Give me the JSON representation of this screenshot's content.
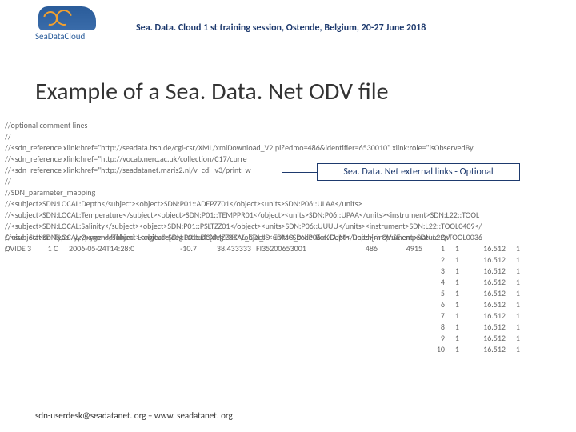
{
  "brand": {
    "name": "SeaDataCloud"
  },
  "header": "Sea. Data. Cloud 1 st training session, Ostende, Belgium, 20-27 June 2018",
  "title": "Example of a Sea. Data. Net ODV file",
  "callout": "Sea. Data. Net external links - Optional",
  "footer": "sdn-userdesk@seadatanet. org – www. seadatanet. org",
  "file": {
    "l0": "//optional comment lines",
    "l1": "//",
    "l2": "//<sdn_reference xlink:href=\"http://seadata.bsh.de/cgi-csr/XML/xmlDownload_V2.pl?edmo=486&identifier=6530010\" xlink:role=\"isObservedBy",
    "l3": "//<sdn_reference xlink:href=\"http://vocab.nerc.ac.uk/collection/C17/curre",
    "l4": "//<sdn_reference xlink:href=\"http://seadatanet.maris2.nl/v_cdi_v3/print_w",
    "l5": "//",
    "l6": "//SDN_parameter_mapping",
    "l7": "//<subject>SDN:LOCAL:Depth</subject><object>SDN:P01::ADEPZZ01</object><units>SDN:P06::ULAA</units>",
    "l8": "//<subject>SDN:LOCAL:Temperature</subject><object>SDN:P01::TEMPPR01</object><units>SDN:P06::UPAA</units><instrument>SDN:L22::TOOL",
    "l9": "//<subject>SDN:LOCAL:Salinity</subject><object>SDN:P01::PSLTZZ01</object><units>SDN:P06::UUUU</units><instrument>SDN:L22::TOOL0409</",
    "l10": "//<subject>SDN:LOCAL:Oxygen</subject><object>SDN:P01::DOXMZZXX</object><units>SDN:P06::KGUM</units><instrument>SDN:L22::TOOL0036",
    "l11": "//"
  },
  "columns": "Cruise   Station  Type   yyyy-mm-ddThh:mi  Longitude[deg Latitude[deg LOCAL_CDI_ID  EDMO_code  Bot. Depth  Depth[m QV:SE emperature QV",
  "meta": {
    "cruise": "OVIDE 3",
    "station": "1  C",
    "datetime": "2006-05-24T14:28:0",
    "lon": "-10.7",
    "lat": "38.433333",
    "cdi": "FI35200653001",
    "edmo": "486",
    "bot": "4915"
  },
  "rows": [
    {
      "dep": "1",
      "qv": "1",
      "tmp": "16.512",
      "qv2": "1"
    },
    {
      "dep": "2",
      "qv": "1",
      "tmp": "16.512",
      "qv2": "1"
    },
    {
      "dep": "3",
      "qv": "1",
      "tmp": "16.512",
      "qv2": "1"
    },
    {
      "dep": "4",
      "qv": "1",
      "tmp": "16.512",
      "qv2": "1"
    },
    {
      "dep": "5",
      "qv": "1",
      "tmp": "16.512",
      "qv2": "1"
    },
    {
      "dep": "6",
      "qv": "1",
      "tmp": "16.512",
      "qv2": "1"
    },
    {
      "dep": "7",
      "qv": "1",
      "tmp": "16.512",
      "qv2": "1"
    },
    {
      "dep": "8",
      "qv": "1",
      "tmp": "16.512",
      "qv2": "1"
    },
    {
      "dep": "9",
      "qv": "1",
      "tmp": "16.512",
      "qv2": "1"
    },
    {
      "dep": "10",
      "qv": "1",
      "tmp": "16.512",
      "qv2": "1"
    }
  ]
}
